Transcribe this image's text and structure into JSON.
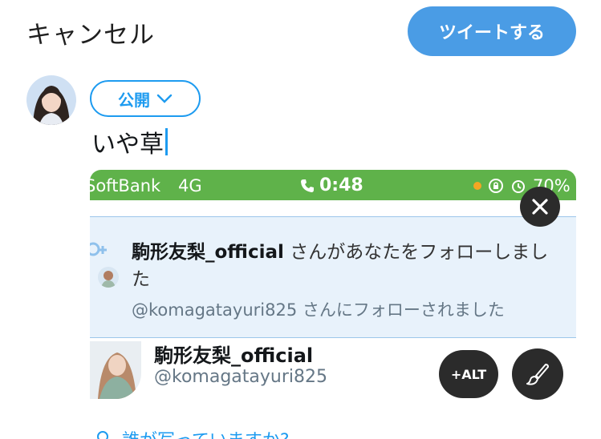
{
  "header": {
    "cancel_label": "キャンセル",
    "tweet_button_label": "ツイートする"
  },
  "composer": {
    "audience_label": "公開",
    "text": "いや草"
  },
  "screenshot": {
    "status_bar": {
      "carrier": "SoftBank",
      "network": "4G",
      "time": "0:48",
      "battery": "70%"
    },
    "notification": {
      "name": "駒形友梨_official",
      "message_start": "さんがあなたをフォローしまし",
      "message_end": "た",
      "sub": "@komagatayuri825 さんにフォローされました"
    },
    "user_card": {
      "name": "駒形友梨_official",
      "handle": "@komagatayuri825"
    }
  },
  "media_controls": {
    "alt_label": "+ALT"
  },
  "tag_prompt": {
    "label": "誰が写っていますか?"
  },
  "colors": {
    "accent": "#1d9bf0",
    "tweet_button": "#4a9ce5",
    "status_bar_green": "#5fb24a",
    "notification_bg": "#e8f2fb",
    "overlay_button": "#2b2b2b"
  },
  "icons": [
    "chevron-down-icon",
    "phone-icon",
    "close-icon",
    "brush-icon",
    "person-icon",
    "orientation-lock-icon",
    "alarm-icon"
  ]
}
